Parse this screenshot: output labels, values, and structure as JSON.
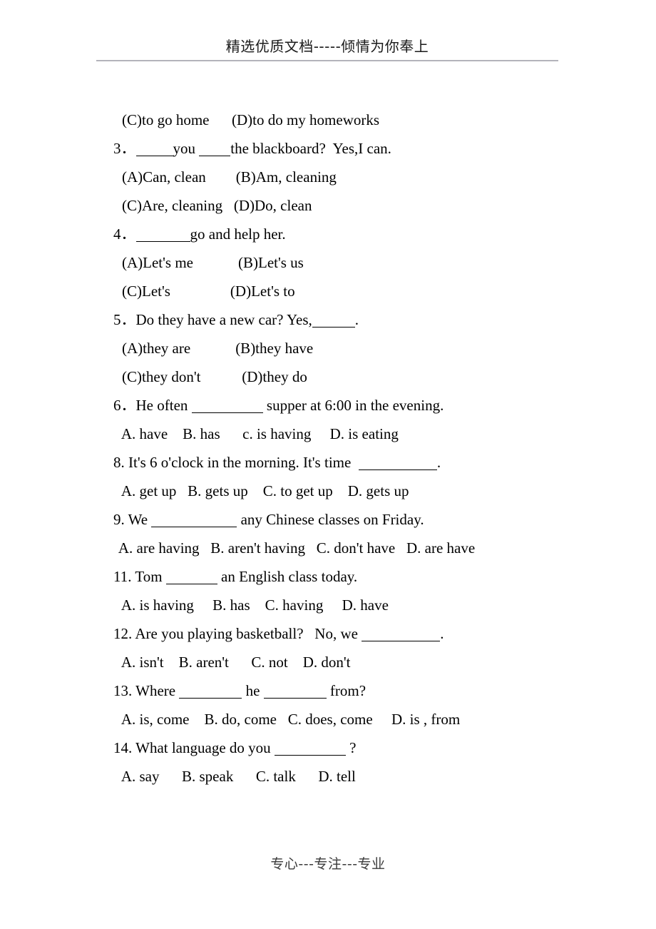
{
  "header": {
    "text": "精选优质文档-----倾情为你奉上",
    "rule_color": "#b3b3bb"
  },
  "footer": {
    "text": "专心---专注---专业"
  },
  "document": {
    "lines": [
      {
        "id": "q2-options-cd",
        "kind": "options",
        "text": "(C)to go home      (D)to do my homeworks"
      },
      {
        "id": "q3-stem-a",
        "kind": "stem",
        "prefix": "3．",
        "mid": "you ",
        "suffix": "the blackboard?  Yes,I can."
      },
      {
        "id": "q3-options-ab",
        "kind": "options",
        "text": "(A)Can, clean        (B)Am, cleaning"
      },
      {
        "id": "q3-options-cd",
        "kind": "options",
        "text": "(C)Are, cleaning   (D)Do, clean"
      },
      {
        "id": "q4-stem",
        "kind": "stem",
        "prefix": "4．",
        "suffix": "go and help her."
      },
      {
        "id": "q4-options-ab",
        "kind": "options",
        "text": "(A)Let's me            (B)Let's us"
      },
      {
        "id": "q4-options-cd",
        "kind": "options",
        "text": "(C)Let's                (D)Let's to"
      },
      {
        "id": "q5-stem",
        "kind": "stem",
        "prefix": "5．",
        "pre": "Do they have a new car? Yes,",
        "suffix": "."
      },
      {
        "id": "q5-options-ab",
        "kind": "options",
        "text": "(A)they are            (B)they have"
      },
      {
        "id": "q5-options-cd",
        "kind": "options",
        "text": "(C)they don't           (D)they do"
      },
      {
        "id": "q6-stem",
        "kind": "stem",
        "prefix": "6．",
        "pre": "He often ",
        "suffix": " supper at 6:00 in the evening."
      },
      {
        "id": "q6-options",
        "kind": "options",
        "text": "A. have    B. has      c. is having     D. is eating"
      },
      {
        "id": "q8-stem",
        "kind": "stem",
        "prefix": "8. ",
        "pre": "It's 6 o'clock in the morning. It's time  ",
        "suffix": "."
      },
      {
        "id": "q8-options",
        "kind": "options",
        "text": "A. get up   B. gets up    C. to get up    D. gets up"
      },
      {
        "id": "q9-stem",
        "kind": "stem",
        "prefix": "9. ",
        "pre": "We ",
        "suffix": " any Chinese classes on Friday."
      },
      {
        "id": "q9-options",
        "kind": "options",
        "text": "A. are having   B. aren't having   C. don't have   D. are have"
      },
      {
        "id": "q11-stem",
        "kind": "stem",
        "prefix": "11. ",
        "pre": "Tom ",
        "suffix": " an English class today."
      },
      {
        "id": "q11-options",
        "kind": "options",
        "text": "A. is having     B. has    C. having     D. have"
      },
      {
        "id": "q12-stem",
        "kind": "stem",
        "prefix": "12. ",
        "pre": "Are you playing basketball?   No, we ",
        "suffix": "."
      },
      {
        "id": "q12-options",
        "kind": "options",
        "text": "A. isn't    B. aren't      C. not    D. don't"
      },
      {
        "id": "q13-stem",
        "kind": "stem",
        "prefix": "13. ",
        "pre": "Where ",
        "mid": " he ",
        "suffix": " from?"
      },
      {
        "id": "q13-options",
        "kind": "options",
        "text": "A. is, come    B. do, come   C. does, come     D. is , from"
      },
      {
        "id": "q14-stem",
        "kind": "stem",
        "prefix": "14. ",
        "pre": "What language do you ",
        "suffix": " ?"
      },
      {
        "id": "q14-options",
        "kind": "options",
        "text": "A. say      B. speak      C. talk      D. tell"
      }
    ]
  }
}
